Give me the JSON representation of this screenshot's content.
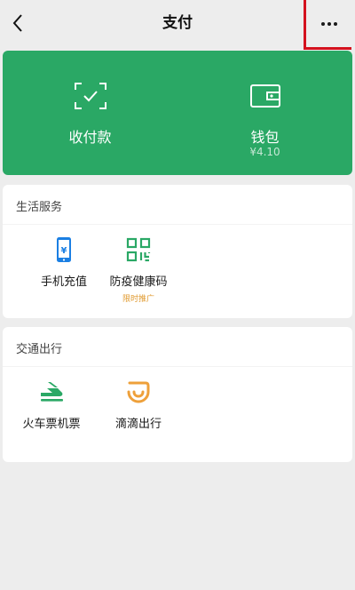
{
  "header": {
    "title": "支付"
  },
  "pay_card": {
    "items": [
      {
        "label": "收付款",
        "icon": "scan-icon"
      },
      {
        "label": "钱包",
        "balance": "¥4.10",
        "icon": "wallet-icon"
      }
    ]
  },
  "sections": [
    {
      "title": "生活服务",
      "services": [
        {
          "label": "手机充值",
          "icon": "phone-recharge-icon"
        },
        {
          "label": "防疫健康码",
          "tag": "限时推广",
          "icon": "qr-code-icon"
        }
      ]
    },
    {
      "title": "交通出行",
      "services": [
        {
          "label": "火车票机票",
          "icon": "train-icon"
        },
        {
          "label": "滴滴出行",
          "icon": "didi-icon"
        }
      ]
    }
  ],
  "colors": {
    "brand_green": "#2aa865",
    "blue_icon": "#1b7fe3",
    "orange_icon": "#eea03a",
    "tag_orange": "#e09a2f",
    "highlight_red": "#d4121e"
  }
}
